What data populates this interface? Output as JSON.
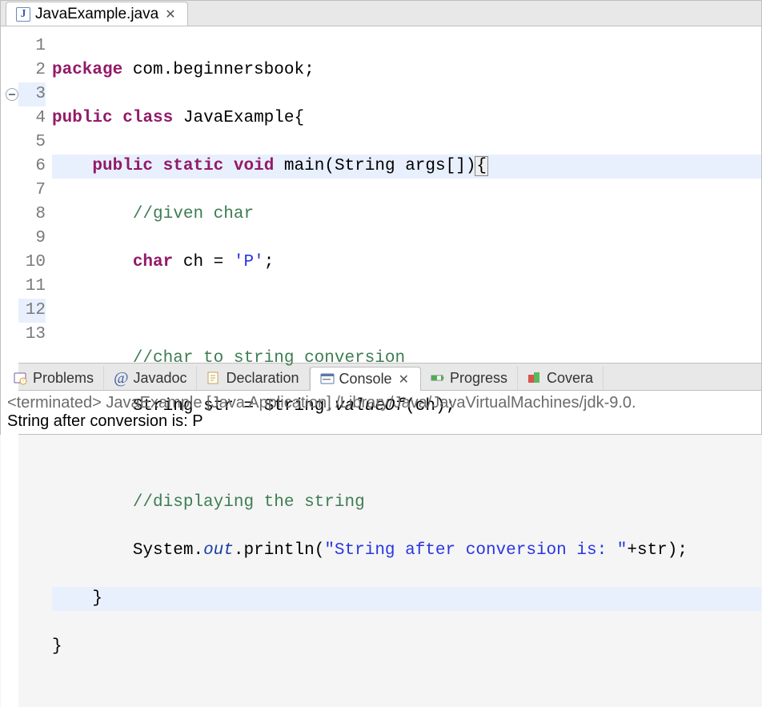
{
  "editor": {
    "tab": {
      "filename": "JavaExample.java"
    },
    "lines": [
      "1",
      "2",
      "3",
      "4",
      "5",
      "6",
      "7",
      "8",
      "9",
      "10",
      "11",
      "12",
      "13"
    ],
    "kw": {
      "package": "package",
      "public": "public",
      "class": "class",
      "static": "static",
      "void": "void",
      "char": "char"
    },
    "pkg_name": "com.beginnersbook",
    "class_name": "JavaExample",
    "main_name": "main",
    "string_type": "String",
    "args": "args[]",
    "comment_given": "//given char",
    "ch_decl": "ch",
    "ch_val": "'P'",
    "comment_conv": "//char to string conversion",
    "str_decl": "str",
    "valueof": "valueOf",
    "comment_disp": "//displaying the string",
    "system": "System",
    "out": "out",
    "println": "println",
    "print_str": "\"String after conversion is: \"",
    "plus_str": "+str"
  },
  "bottom_tabs": {
    "problems": "Problems",
    "javadoc": "Javadoc",
    "declaration": "Declaration",
    "console": "Console",
    "progress": "Progress",
    "coverage": "Covera"
  },
  "console": {
    "status": "<terminated> JavaExample [Java Application] /Library/Java/JavaVirtualMachines/jdk-9.0.",
    "output": "String after conversion is: P"
  }
}
